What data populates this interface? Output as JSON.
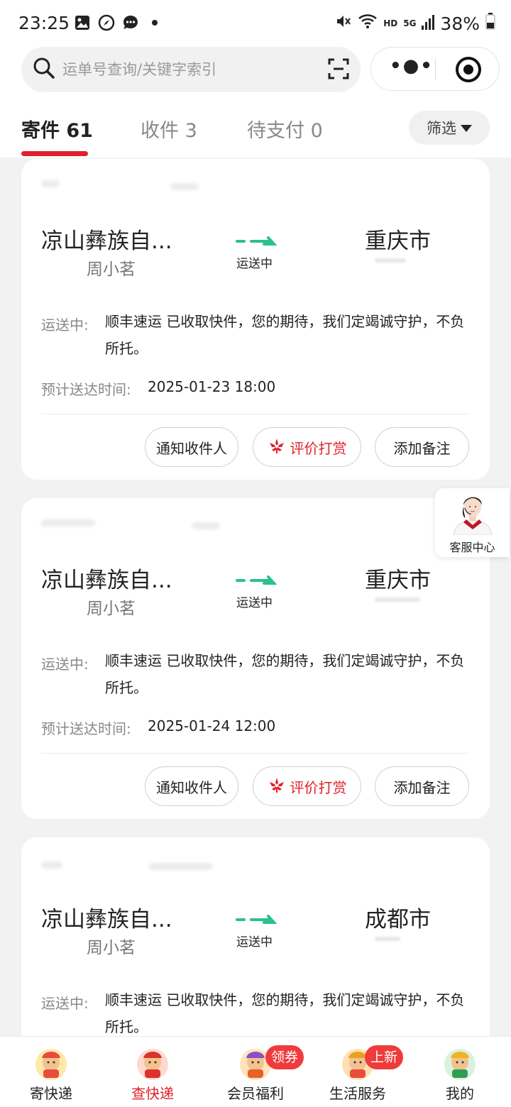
{
  "status_bar": {
    "time": "23:25",
    "network": "HD",
    "signal": "5G",
    "battery": "38%"
  },
  "search": {
    "placeholder": "运单号查询/关键字索引"
  },
  "tabs": [
    {
      "label": "寄件 61"
    },
    {
      "label": "收件 3"
    },
    {
      "label": "待支付 0"
    }
  ],
  "filter": {
    "label": "筛选"
  },
  "orders": [
    {
      "from_city": "凉山彝族自...",
      "sender": "周小茗",
      "route_status": "运送中",
      "to_city": "重庆市",
      "status_label": "运送中:",
      "status_text": "顺丰速运 已收取快件，您的期待，我们定竭诚守护，不负所托。",
      "eta_label": "预计送达时间:",
      "eta": "2025-01-23 18:00"
    },
    {
      "from_city": "凉山彝族自...",
      "sender": "周小茗",
      "route_status": "运送中",
      "to_city": "重庆市",
      "status_label": "运送中:",
      "status_text": "顺丰速运 已收取快件，您的期待，我们定竭诚守护，不负所托。",
      "eta_label": "预计送达时间:",
      "eta": "2025-01-24 12:00"
    },
    {
      "from_city": "凉山彝族自...",
      "sender": "周小茗",
      "route_status": "运送中",
      "to_city": "成都市",
      "status_label": "运送中:",
      "status_text": "顺丰速运 已收取快件，您的期待，我们定竭诚守护，不负所托。"
    }
  ],
  "actions": {
    "notify": "通知收件人",
    "rate": "评价打赏",
    "note": "添加备注"
  },
  "customer_service": {
    "label": "客服中心"
  },
  "bottom_nav": [
    {
      "label": "寄快递"
    },
    {
      "label": "查快递"
    },
    {
      "label": "会员福利",
      "badge": "领券"
    },
    {
      "label": "生活服务",
      "badge": "上新"
    },
    {
      "label": "我的"
    }
  ],
  "colors": {
    "accent": "#e0202a",
    "route_green": "#2cc08a"
  }
}
